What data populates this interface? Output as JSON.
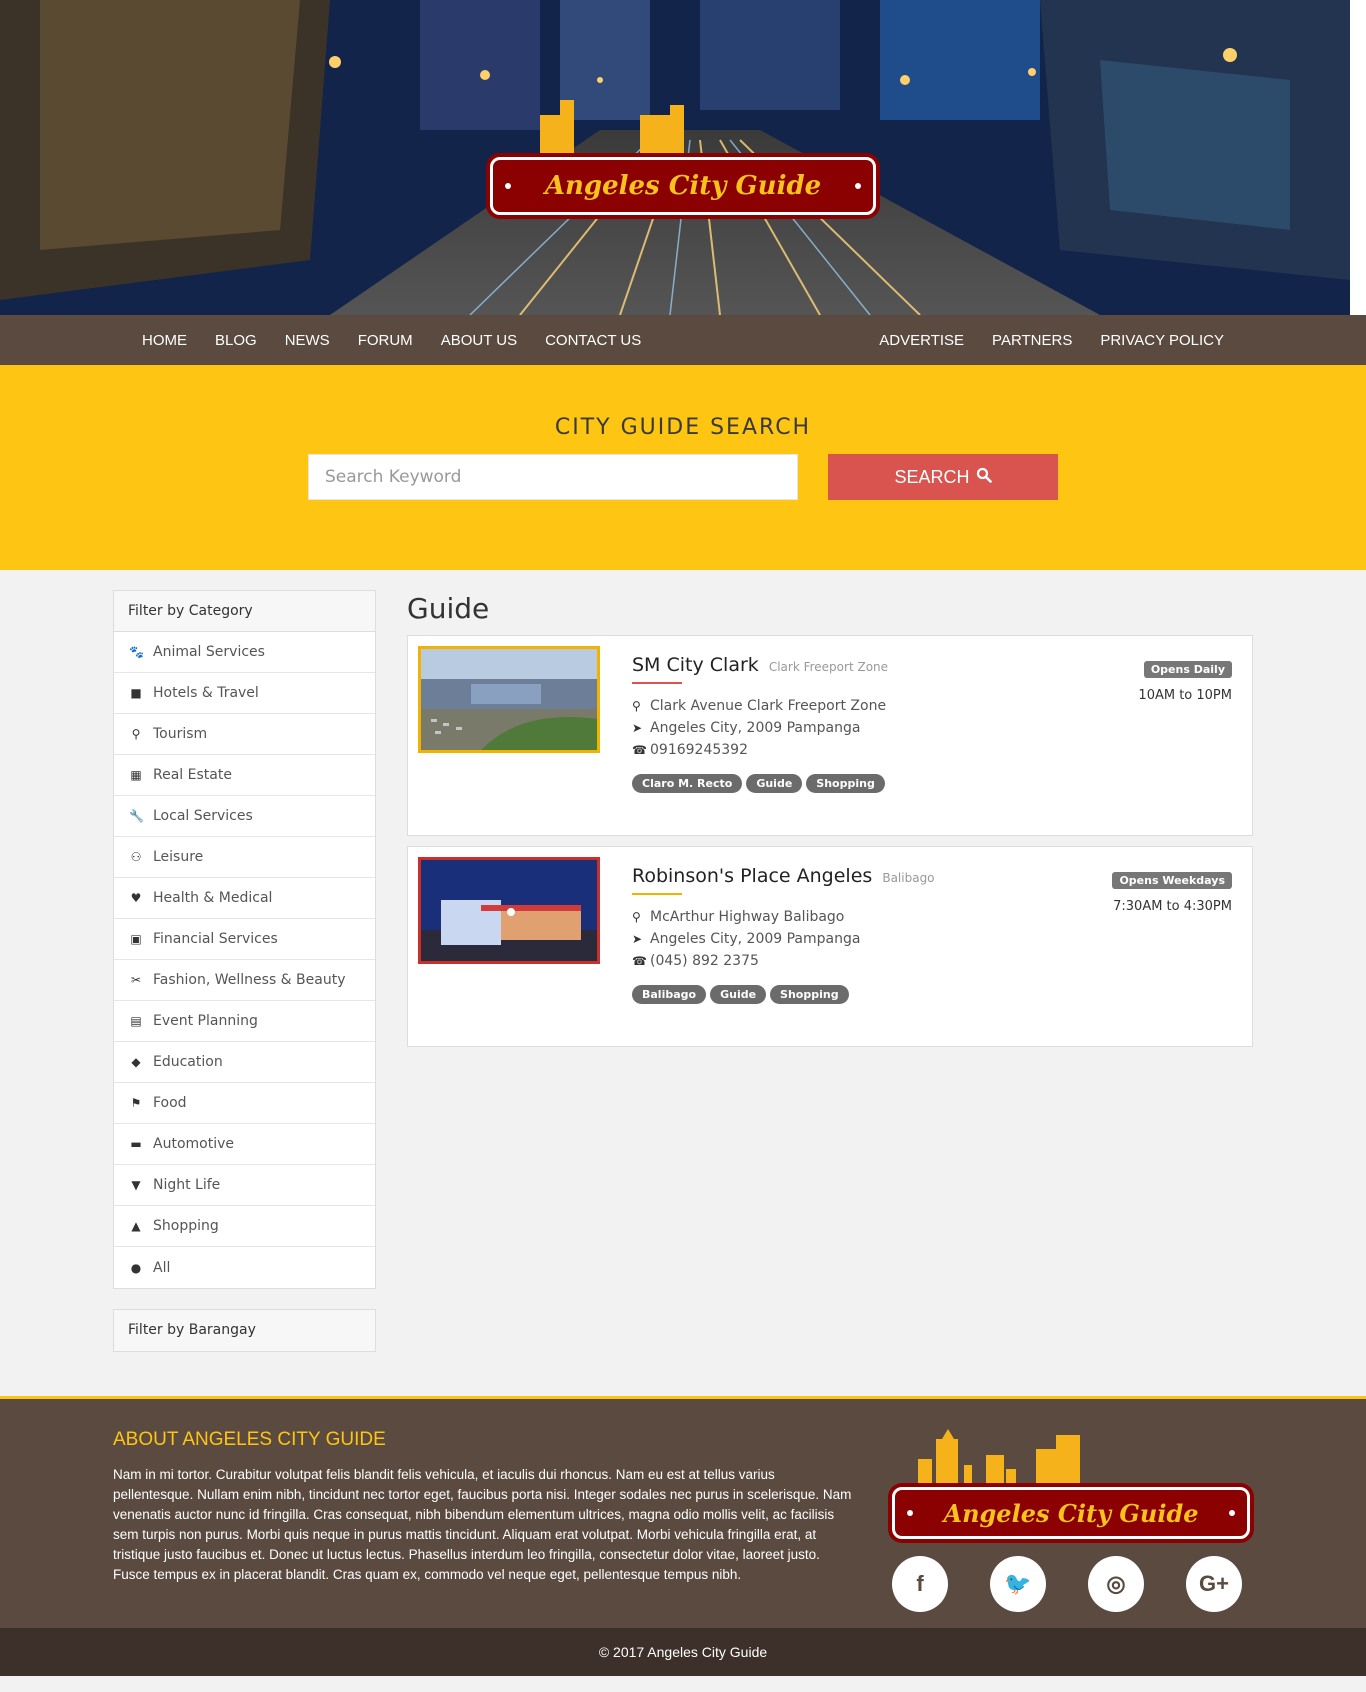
{
  "brand": {
    "logo_text": "Angeles City Guide"
  },
  "nav": {
    "left": [
      "HOME",
      "BLOG",
      "NEWS",
      "FORUM",
      "ABOUT US",
      "CONTACT US"
    ],
    "right": [
      "ADVERTISE",
      "PARTNERS",
      "PRIVACY POLICY"
    ]
  },
  "search": {
    "title": "CITY GUIDE SEARCH",
    "placeholder": "Search Keyword",
    "button_label": "SEARCH"
  },
  "sidebar": {
    "category_title": "Filter by Category",
    "categories": [
      {
        "label": "Animal Services",
        "icon": "paw-icon"
      },
      {
        "label": "Hotels & Travel",
        "icon": "suitcase-icon"
      },
      {
        "label": "Tourism",
        "icon": "map-marker-icon"
      },
      {
        "label": "Real Estate",
        "icon": "building-icon"
      },
      {
        "label": "Local Services",
        "icon": "wrench-icon"
      },
      {
        "label": "Leisure",
        "icon": "bicycle-icon"
      },
      {
        "label": "Health & Medical",
        "icon": "heartbeat-icon"
      },
      {
        "label": "Financial Services",
        "icon": "money-icon"
      },
      {
        "label": "Fashion, Wellness & Beauty",
        "icon": "scissors-icon"
      },
      {
        "label": "Event Planning",
        "icon": "calendar-icon"
      },
      {
        "label": "Education",
        "icon": "graduation-cap-icon"
      },
      {
        "label": "Food",
        "icon": "cutlery-icon"
      },
      {
        "label": "Automotive",
        "icon": "car-icon"
      },
      {
        "label": "Night Life",
        "icon": "glass-icon"
      },
      {
        "label": "Shopping",
        "icon": "shopping-bag-icon"
      },
      {
        "label": "All",
        "icon": "globe-icon"
      }
    ],
    "barangay_title": "Filter by Barangay"
  },
  "main": {
    "heading": "Guide",
    "listings": [
      {
        "title": "SM City Clark",
        "subtitle": "Clark Freeport Zone",
        "address": "Clark Avenue Clark Freeport Zone",
        "city": "Angeles City, 2009 Pampanga",
        "phone": "09169245392",
        "tags": [
          "Claro M. Recto",
          "Guide",
          "Shopping"
        ],
        "badge": "Opens Daily",
        "hours": "10AM to 10PM",
        "accent": "#d9534f"
      },
      {
        "title": "Robinson's Place Angeles",
        "subtitle": "Balibago",
        "address": "McArthur Highway Balibago",
        "city": "Angeles City, 2009 Pampanga",
        "phone": "(045) 892 2375",
        "tags": [
          "Balibago",
          "Guide",
          "Shopping"
        ],
        "badge": "Opens Weekdays",
        "hours": "7:30AM to 4:30PM",
        "accent": "#f0b300"
      }
    ]
  },
  "footer": {
    "about_title": "ABOUT ANGELES CITY GUIDE",
    "about_text": "Nam in mi tortor. Curabitur volutpat felis blandit felis vehicula, et iaculis dui rhoncus. Nam eu est at tellus varius pellentesque. Nullam enim nibh, tincidunt nec tortor eget, faucibus porta nisi. Integer sodales nec purus in scelerisque. Nam venenatis auctor nunc id fringilla. Cras consequat, nibh bibendum elementum ultrices, magna odio mollis velit, ac facilisis sem turpis non purus. Morbi quis neque in purus mattis tincidunt. Aliquam erat volutpat. Morbi vehicula fringilla erat, at tristique justo faucibus et. Donec ut luctus lectus. Phasellus interdum leo fringilla, consectetur dolor vitae, laoreet justo. Fusce tempus ex in placerat blandit. Cras quam ex, commodo vel neque eget, pellentesque tempus nibh.",
    "socials": [
      {
        "glyph": "f",
        "icon": "facebook-icon"
      },
      {
        "glyph": "🐦",
        "icon": "twitter-icon"
      },
      {
        "glyph": "◎",
        "icon": "instagram-icon"
      },
      {
        "glyph": "G+",
        "icon": "google-plus-icon"
      }
    ],
    "copyright": "© 2017 Angeles City Guide"
  },
  "colors": {
    "nav_bg": "#5a4a40",
    "search_band": "#fec513",
    "search_button": "#d9534f",
    "logo_plate": "#8b0000",
    "logo_text": "#f6c21b"
  }
}
